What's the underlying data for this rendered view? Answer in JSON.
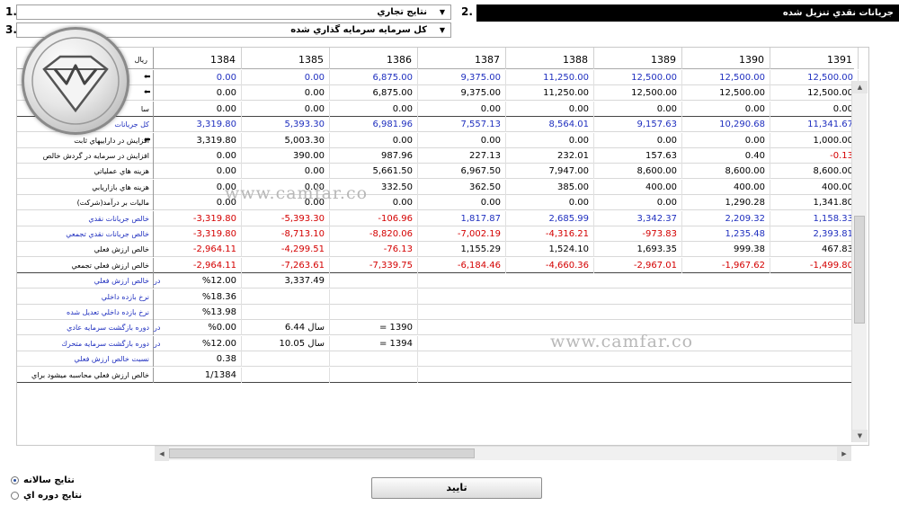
{
  "header": {
    "label1": "1.",
    "label2": "2.",
    "label3": "3.",
    "dropdown1_value": "نتايج تجاري",
    "dropdown2_value": "كل سرمايه سرمايه گذاري شده",
    "title": "جريانات نقدي تنزيل شده"
  },
  "grid": {
    "unit_label": "ريال",
    "years": [
      "1384",
      "1385",
      "1386",
      "1387",
      "1388",
      "1389",
      "1390",
      "1391"
    ],
    "rows": [
      {
        "label": "",
        "label_color": "black",
        "marker": "⬅",
        "values": [
          "0.00",
          "0.00",
          "6,875.00",
          "9,375.00",
          "11,250.00",
          "12,500.00",
          "12,500.00",
          "12,500.00"
        ],
        "colors": [
          "blue",
          "blue",
          "blue",
          "blue",
          "blue",
          "blue",
          "blue",
          "blue"
        ]
      },
      {
        "label": "",
        "label_color": "black",
        "marker": "⬅",
        "values": [
          "0.00",
          "0.00",
          "6,875.00",
          "9,375.00",
          "11,250.00",
          "12,500.00",
          "12,500.00",
          "12,500.00"
        ],
        "colors": [
          "black",
          "black",
          "black",
          "black",
          "black",
          "black",
          "black",
          "black"
        ]
      },
      {
        "label": "سا",
        "label_color": "black",
        "marker": "",
        "values": [
          "0.00",
          "0.00",
          "0.00",
          "0.00",
          "0.00",
          "0.00",
          "0.00",
          "0.00"
        ],
        "colors": [
          "black",
          "black",
          "black",
          "black",
          "black",
          "black",
          "black",
          "black"
        ]
      },
      {
        "label": "كل جريانات",
        "label_color": "blue",
        "marker": "",
        "values": [
          "3,319.80",
          "5,393.30",
          "6,981.96",
          "7,557.13",
          "8,564.01",
          "9,157.63",
          "10,290.68",
          "11,341.67"
        ],
        "colors": [
          "blue",
          "blue",
          "blue",
          "blue",
          "blue",
          "blue",
          "blue",
          "blue"
        ]
      },
      {
        "label": "افزايش در داراييهاي ثابت",
        "label_color": "black",
        "marker": "⬅",
        "values": [
          "3,319.80",
          "5,003.30",
          "0.00",
          "0.00",
          "0.00",
          "0.00",
          "0.00",
          "1,000.00"
        ],
        "colors": [
          "black",
          "black",
          "black",
          "black",
          "black",
          "black",
          "black",
          "black"
        ]
      },
      {
        "label": "افزايش در سرمايه در گردش خالص",
        "label_color": "black",
        "marker": "",
        "values": [
          "0.00",
          "390.00",
          "987.96",
          "227.13",
          "232.01",
          "157.63",
          "0.40",
          "-0.13"
        ],
        "colors": [
          "black",
          "black",
          "black",
          "black",
          "black",
          "black",
          "black",
          "red"
        ]
      },
      {
        "label": "هزينه هاي عملياتي",
        "label_color": "black",
        "marker": "",
        "values": [
          "0.00",
          "0.00",
          "5,661.50",
          "6,967.50",
          "7,947.00",
          "8,600.00",
          "8,600.00",
          "8,600.00"
        ],
        "colors": [
          "black",
          "black",
          "black",
          "black",
          "black",
          "black",
          "black",
          "black"
        ]
      },
      {
        "label": "هزينه هاي بازاريابي",
        "label_color": "black",
        "marker": "",
        "values": [
          "0.00",
          "0.00",
          "332.50",
          "362.50",
          "385.00",
          "400.00",
          "400.00",
          "400.00"
        ],
        "colors": [
          "black",
          "black",
          "black",
          "black",
          "black",
          "black",
          "black",
          "black"
        ]
      },
      {
        "label": "ماليات بر درآمد(شركت)",
        "label_color": "black",
        "marker": "",
        "values": [
          "0.00",
          "0.00",
          "0.00",
          "0.00",
          "0.00",
          "0.00",
          "1,290.28",
          "1,341.80"
        ],
        "colors": [
          "black",
          "black",
          "black",
          "black",
          "black",
          "black",
          "black",
          "black"
        ]
      },
      {
        "label": "خالص جريانات نقدي",
        "label_color": "blue",
        "marker": "",
        "values": [
          "-3,319.80",
          "-5,393.30",
          "-106.96",
          "1,817.87",
          "2,685.99",
          "3,342.37",
          "2,209.32",
          "1,158.33"
        ],
        "colors": [
          "red",
          "red",
          "red",
          "blue",
          "blue",
          "blue",
          "blue",
          "blue"
        ]
      },
      {
        "label": "خالص جريانات نقدي تجمعي",
        "label_color": "blue",
        "marker": "",
        "values": [
          "-3,319.80",
          "-8,713.10",
          "-8,820.06",
          "-7,002.19",
          "-4,316.21",
          "-973.83",
          "1,235.48",
          "2,393.81"
        ],
        "colors": [
          "red",
          "red",
          "red",
          "red",
          "red",
          "red",
          "blue",
          "blue"
        ]
      },
      {
        "label": "خالص ارزش فعلي",
        "label_color": "black",
        "marker": "",
        "values": [
          "-2,964.11",
          "-4,299.51",
          "-76.13",
          "1,155.29",
          "1,524.10",
          "1,693.35",
          "999.38",
          "467.83"
        ],
        "colors": [
          "red",
          "red",
          "red",
          "black",
          "black",
          "black",
          "black",
          "black"
        ]
      },
      {
        "label": "خالص ارزش فعلي تجمعي",
        "label_color": "black",
        "marker": "",
        "values": [
          "-2,964.11",
          "-7,263.61",
          "-7,339.75",
          "-6,184.46",
          "-4,660.36",
          "-2,967.01",
          "-1,967.62",
          "-1,499.80"
        ],
        "colors": [
          "red",
          "red",
          "red",
          "red",
          "red",
          "red",
          "red",
          "red"
        ]
      }
    ],
    "summary_rows": [
      {
        "label": "خالص ارزش فعلي",
        "unit": "در",
        "c1": "%12.00",
        "c2": "3,337.49",
        "c3": ""
      },
      {
        "label": "نرخ بازده داخلي",
        "unit": "",
        "c1": "%18.36",
        "c2": "",
        "c3": ""
      },
      {
        "label": "نرخ بازده داخلي تعديل شده",
        "unit": "",
        "c1": "%13.98",
        "c2": "",
        "c3": ""
      },
      {
        "label": "دوره بازگشت سرمايه عادي",
        "unit": "در",
        "c1": "%0.00",
        "c2": "6.44 سال",
        "c3": "= 1390"
      },
      {
        "label": "دوره بازگشت سرمايه متحرك",
        "unit": "در",
        "c1": "%12.00",
        "c2": "10.05 سال",
        "c3": "= 1394"
      },
      {
        "label": "نسبت خالص ارزش فعلي",
        "unit": "",
        "c1": "0.38",
        "c2": "",
        "c3": ""
      },
      {
        "label": "خالص ارزش فعلي محاسبه ميشود براي",
        "unit": "",
        "c1": "1/1384",
        "c2": "",
        "c3": ""
      }
    ]
  },
  "watermark": "www.camfar.co",
  "options": {
    "annual": "نتايج سالانه",
    "periodic": "نتايج دوره اي"
  },
  "confirm_label": "تاييد"
}
